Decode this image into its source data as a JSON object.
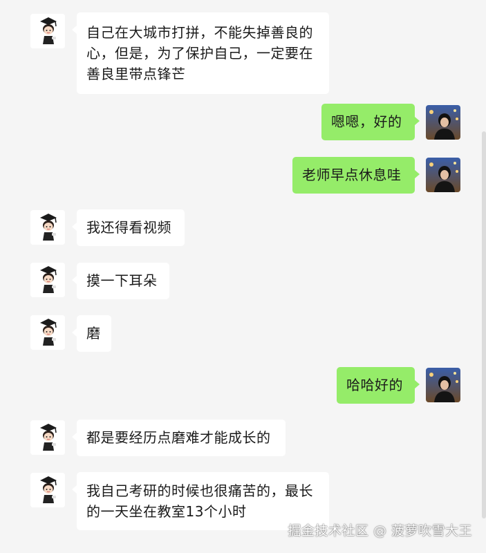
{
  "conversation": {
    "messages": [
      {
        "side": "left",
        "text": "自己在大城市打拼，不能失掉善良的心，但是，为了保护自己，一定要在善良里带点锋芒"
      },
      {
        "side": "right",
        "text": "嗯嗯，好的"
      },
      {
        "side": "right",
        "text": "老师早点休息哇"
      },
      {
        "side": "left",
        "text": "我还得看视频"
      },
      {
        "side": "left",
        "text": "摸一下耳朵"
      },
      {
        "side": "left",
        "text": "磨"
      },
      {
        "side": "right",
        "text": "哈哈好的"
      },
      {
        "side": "left",
        "text": "都是要经历点磨难才能成长的"
      },
      {
        "side": "left",
        "text": "我自己考研的时候也很痛苦的，最长的一天坐在教室13个小时"
      }
    ]
  },
  "watermark": "掘金技术社区 @ 菠萝吹雪大王",
  "colors": {
    "background": "#f5f5f5",
    "incoming_bubble": "#ffffff",
    "outgoing_bubble": "#95ec69"
  },
  "icons": {
    "incoming_avatar": "cartoon-graduate-avatar-icon",
    "outgoing_avatar": "user-photo-avatar"
  }
}
